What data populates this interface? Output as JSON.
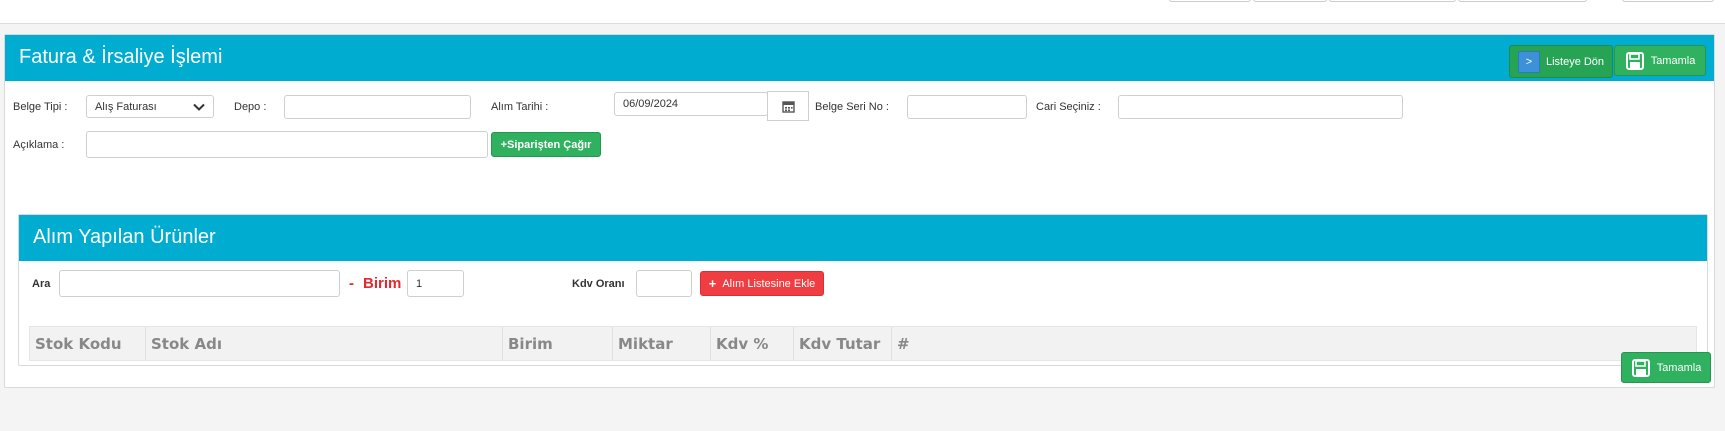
{
  "header": {
    "title": "Fatura & İrsaliye İşlemi"
  },
  "actions": {
    "back_label": "Listeye Dön",
    "back_icon": ">",
    "complete_label": "Tamamla"
  },
  "form": {
    "doc_type_label": "Belge Tipi :",
    "doc_type_value": "Alış Faturası",
    "warehouse_label": "Depo :",
    "warehouse_value": "",
    "date_label": "Alım Tarihi :",
    "date_value": "06/09/2024",
    "serial_label": "Belge Seri No :",
    "serial_value": "",
    "account_label": "Cari Seçiniz :",
    "account_value": "",
    "desc_label": "Açıklama :",
    "desc_value": "",
    "order_button": "+Siparişten Çağır"
  },
  "products": {
    "title": "Alım Yapılan Ürünler",
    "search_label": "Ara",
    "search_value": "",
    "dash": "-",
    "unit_label": "Birim",
    "unit_value": "1",
    "vat_label": "Kdv Oranı",
    "vat_value": "",
    "add_button": "Alım Listesine Ekle",
    "add_icon": "+",
    "columns": [
      "Stok Kodu",
      "Stok Adı",
      "Birim",
      "Miktar",
      "Kdv %",
      "Kdv Tutar",
      "#"
    ]
  },
  "colors": {
    "header": "#00acd0",
    "success": "#2fb15f",
    "danger": "#ef3d42",
    "unit_label": "#e3292f"
  }
}
